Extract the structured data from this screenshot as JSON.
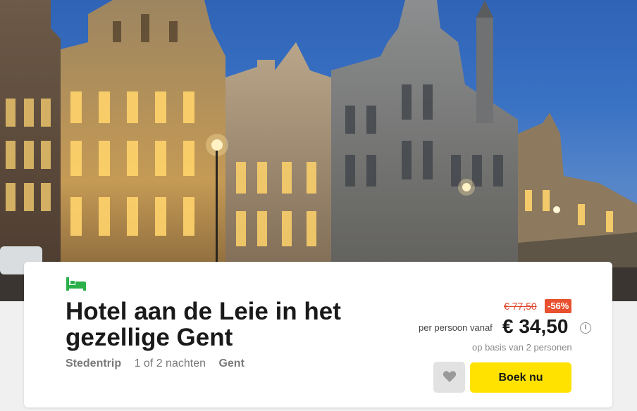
{
  "hotel": {
    "title": "Hotel aan de Leie in het gezellige Gent",
    "type": "Stedentrip",
    "nights": "1 of 2 nachten",
    "city": "Gent",
    "category_icon": "bed-icon"
  },
  "pricing": {
    "old_price": "€ 77,50",
    "discount": "-56%",
    "per_person_label": "per persoon vanaf",
    "price": "€ 34,50",
    "basis": "op basis van 2 personen",
    "info_icon": "info-icon"
  },
  "actions": {
    "favorite_icon": "heart-icon",
    "book_label": "Boek nu"
  },
  "colors": {
    "accent_green": "#2bb04a",
    "book_yellow": "#ffe200",
    "discount_red": "#e8512f"
  }
}
